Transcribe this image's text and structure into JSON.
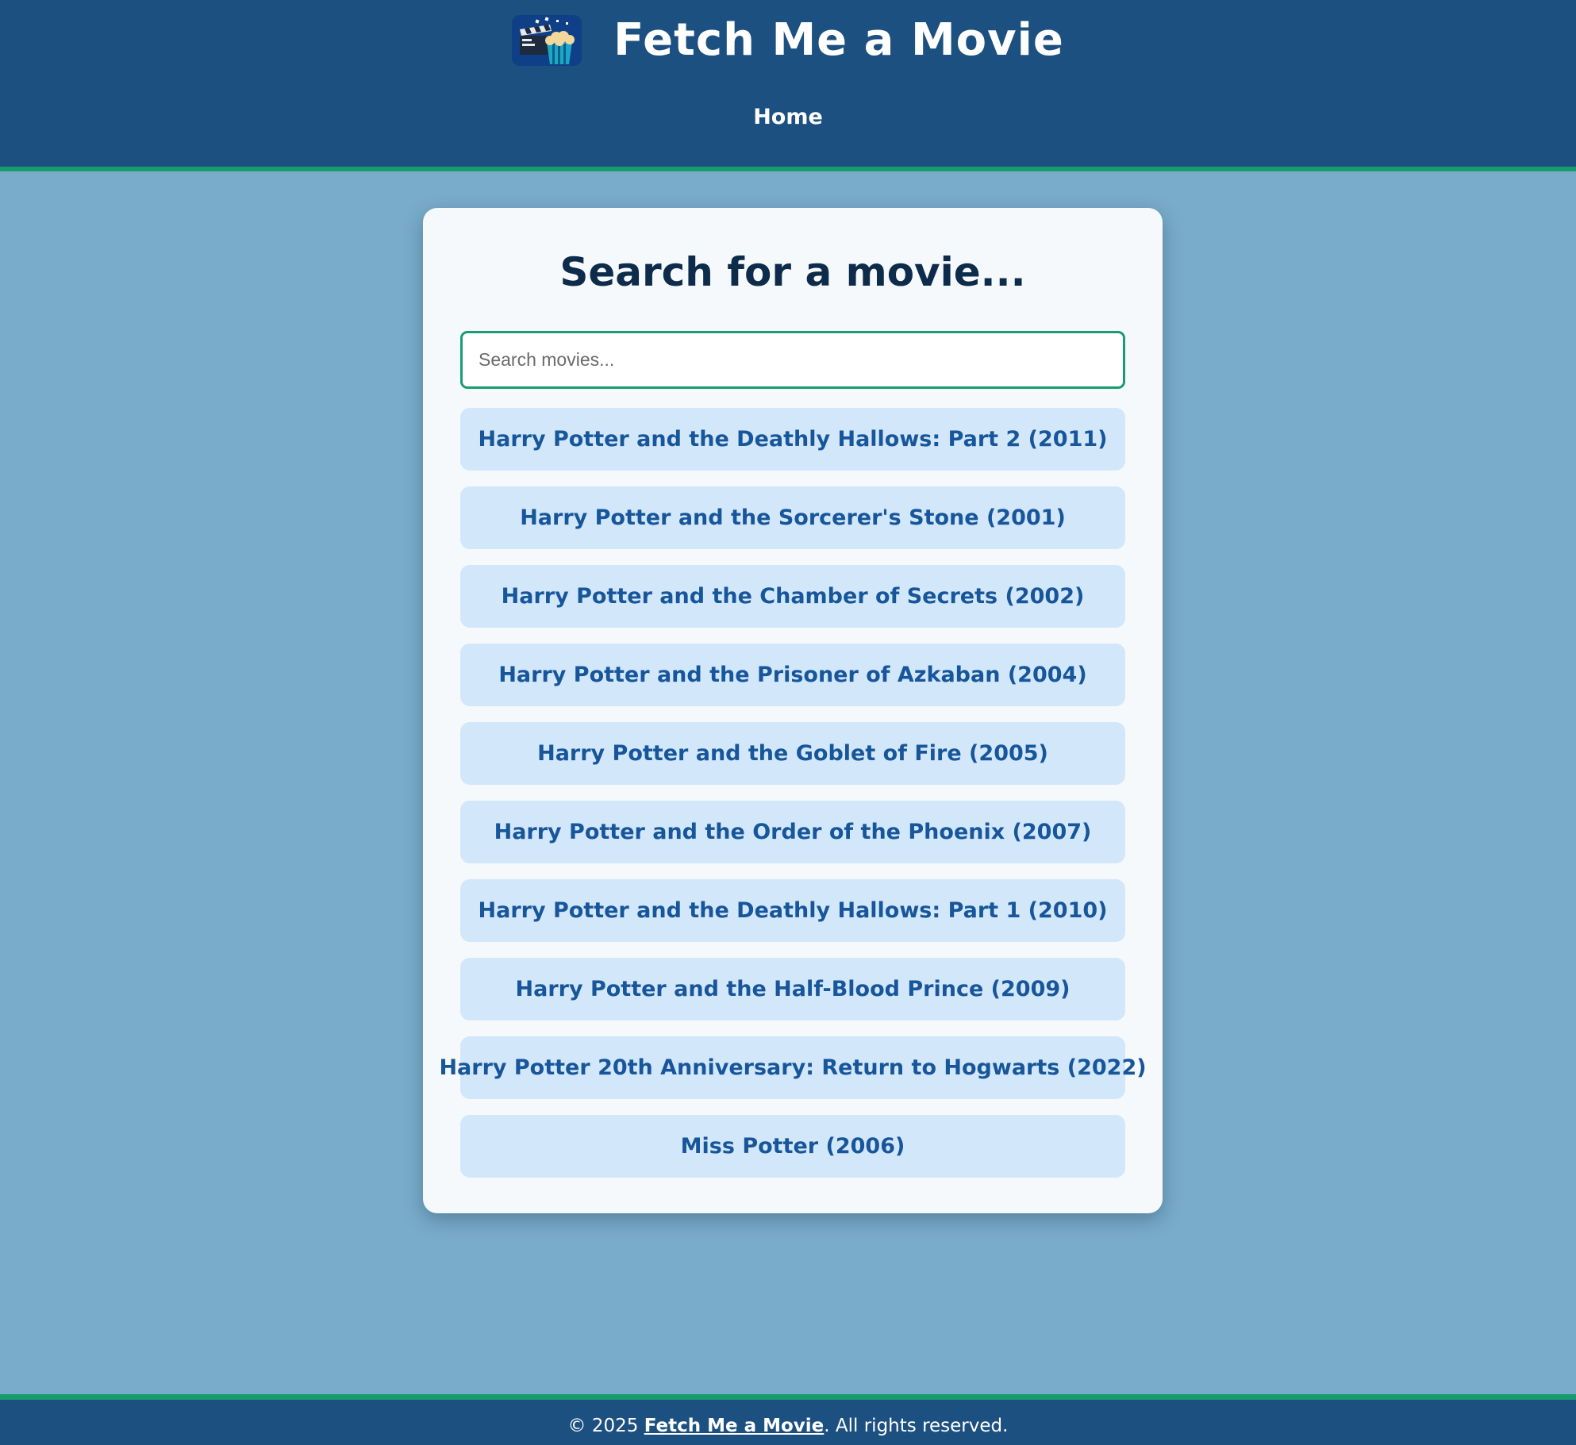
{
  "header": {
    "title": "Fetch Me a Movie",
    "logo_icon": "clapperboard-popcorn-icon",
    "nav": [
      {
        "label": "Home"
      }
    ]
  },
  "main": {
    "heading": "Search for a movie...",
    "search": {
      "placeholder": "Search movies...",
      "value": ""
    },
    "results": [
      "Harry Potter and the Deathly Hallows: Part 2 (2011)",
      "Harry Potter and the Sorcerer's Stone (2001)",
      "Harry Potter and the Chamber of Secrets (2002)",
      "Harry Potter and the Prisoner of Azkaban (2004)",
      "Harry Potter and the Goblet of Fire (2005)",
      "Harry Potter and the Order of the Phoenix (2007)",
      "Harry Potter and the Deathly Hallows: Part 1 (2010)",
      "Harry Potter and the Half-Blood Prince (2009)",
      "Harry Potter 20th Anniversary: Return to Hogwarts (2022)",
      "Miss Potter (2006)"
    ]
  },
  "footer": {
    "prefix": "© 2025 ",
    "link": "Fetch Me a Movie",
    "suffix": ". All rights reserved."
  },
  "colors": {
    "header_bg": "#1c5080",
    "accent": "#179b6d",
    "page_bg": "#79acca",
    "result_bg": "#d3e7fb",
    "result_text": "#17569a"
  }
}
